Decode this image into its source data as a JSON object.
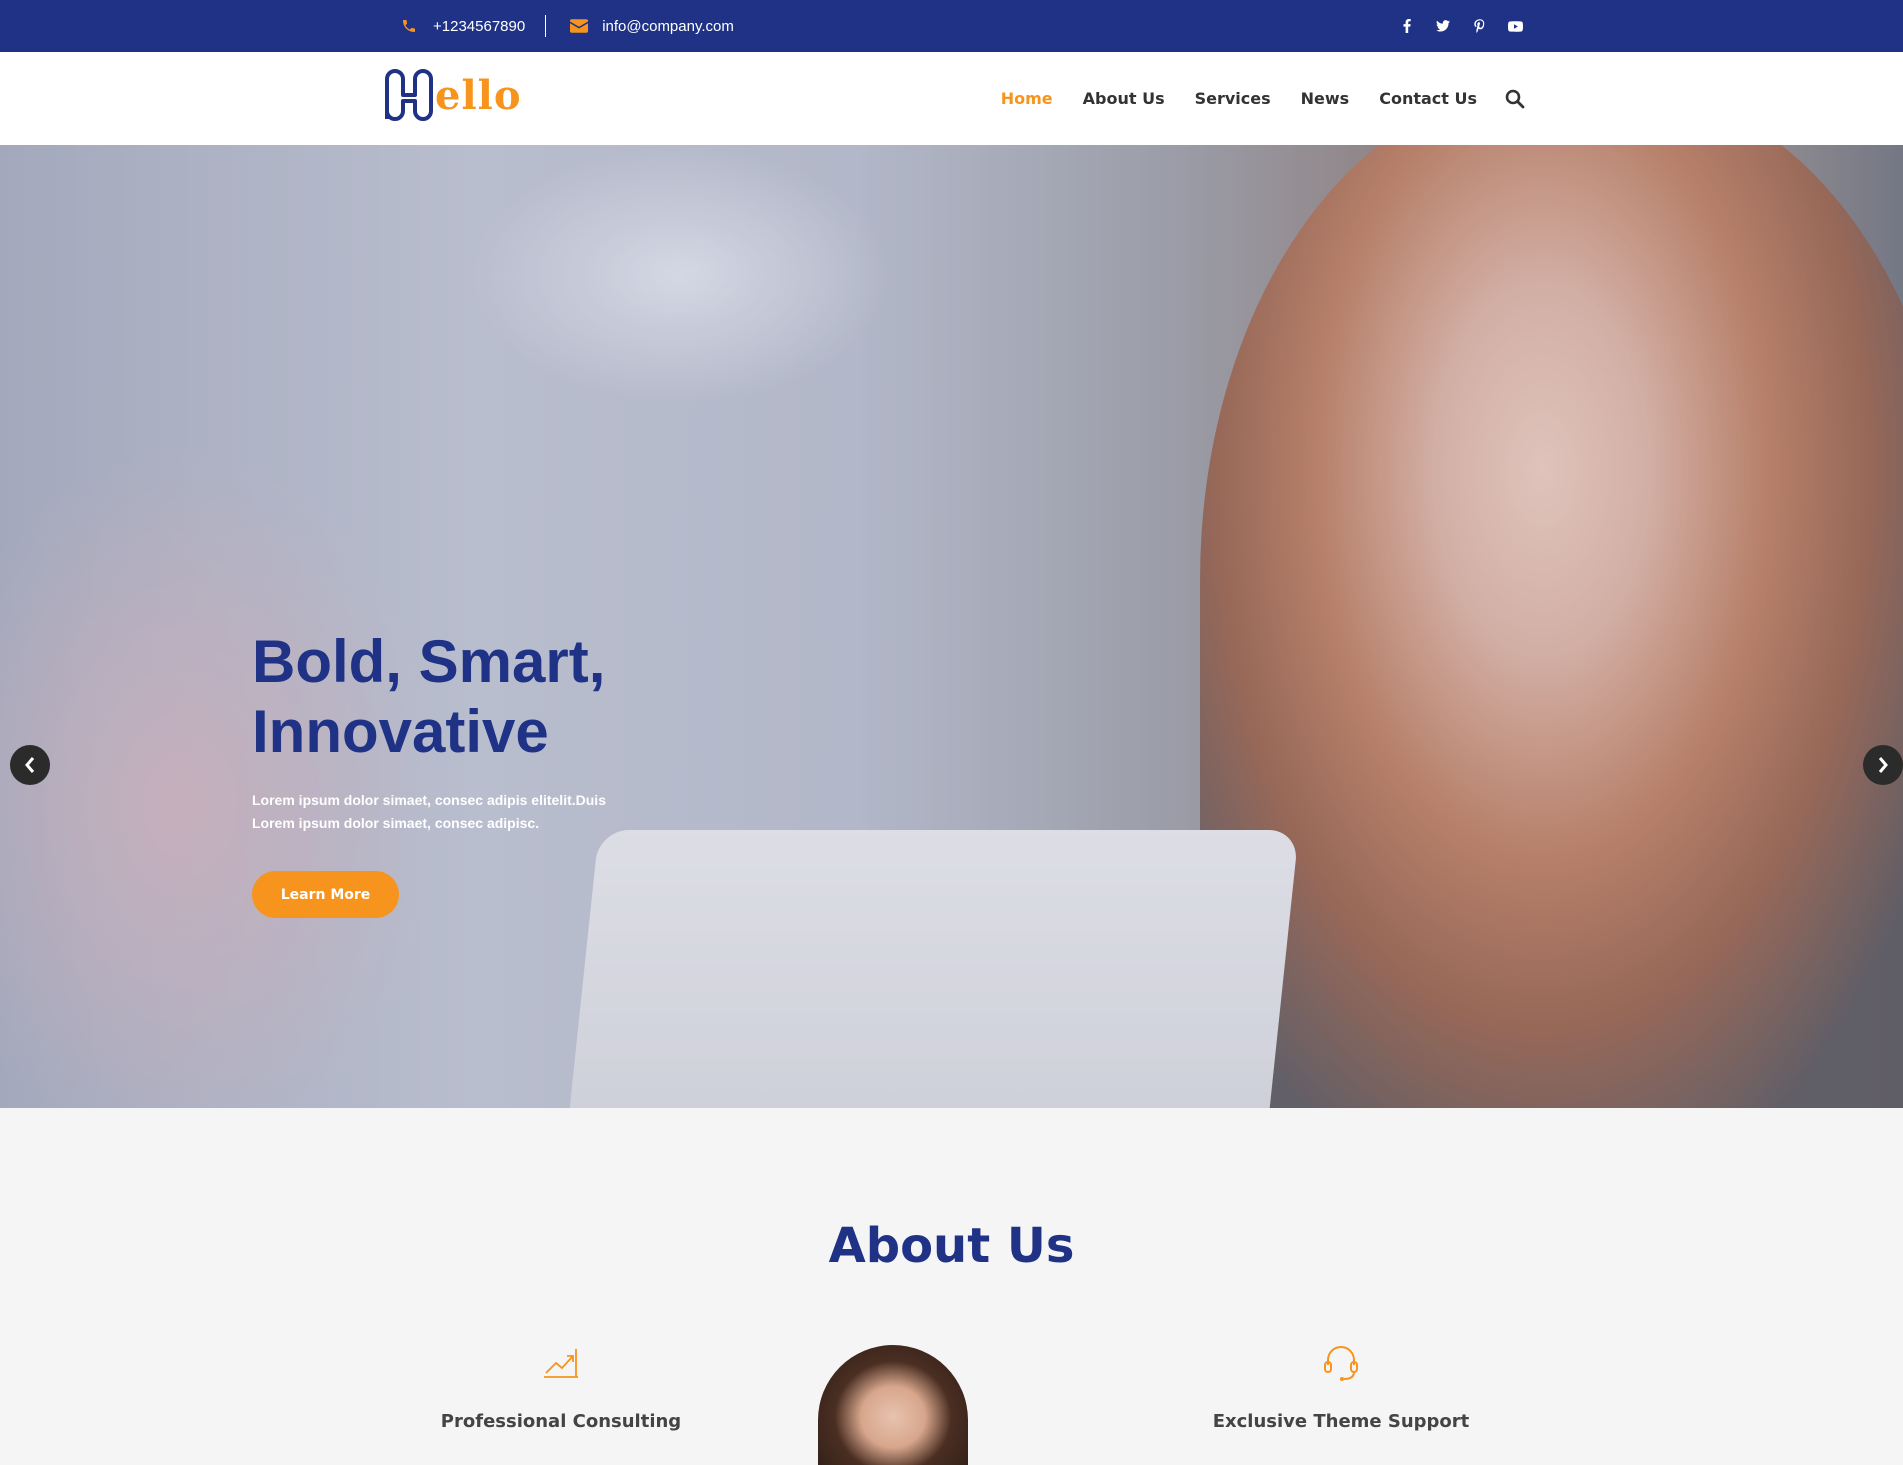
{
  "topbar": {
    "phone": "+1234567890",
    "email": "info@company.com",
    "social": [
      "facebook-icon",
      "twitter-icon",
      "pinterest-icon",
      "youtube-icon"
    ]
  },
  "header": {
    "logo_text": "ello",
    "nav": [
      {
        "label": "Home",
        "active": true
      },
      {
        "label": "About Us",
        "active": false
      },
      {
        "label": "Services",
        "active": false
      },
      {
        "label": "News",
        "active": false
      },
      {
        "label": "Contact Us",
        "active": false
      }
    ]
  },
  "hero": {
    "title_line1": "Bold, Smart,",
    "title_line2": "Innovative",
    "text": "Lorem ipsum dolor simaet, consec adipis elitelit.Duis Lorem ipsum dolor simaet, consec adipisc.",
    "button_label": "Learn More"
  },
  "about": {
    "title": "About Us",
    "features": [
      {
        "icon": "chart-up-icon",
        "label": "Professional Consulting"
      },
      {
        "icon": "headset-icon",
        "label": "Exclusive Theme Support"
      }
    ]
  },
  "colors": {
    "primary": "#1f3285",
    "accent": "#f7941d"
  }
}
